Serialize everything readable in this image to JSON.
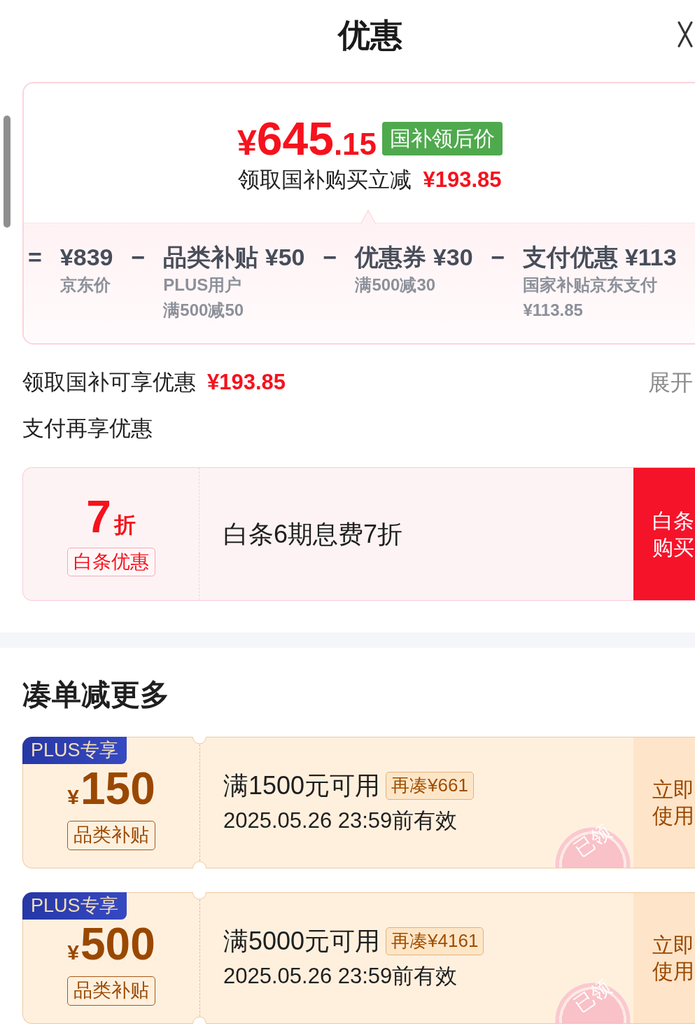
{
  "header": {
    "title": "优惠"
  },
  "price_card": {
    "price": {
      "symbol": "¥",
      "whole": "645",
      "fraction": ".15"
    },
    "tag": "国补领后价",
    "saving_label": "领取国补购买立减",
    "saving_amount": "¥193.85",
    "breakdown": [
      {
        "operator": "=",
        "title": "¥839",
        "notes": [
          "京东价"
        ]
      },
      {
        "operator": "−",
        "title": "品类补贴 ¥50",
        "notes": [
          "PLUS用户",
          "满500减50"
        ]
      },
      {
        "operator": "−",
        "title": "优惠券 ¥30",
        "notes": [
          "满500减30"
        ]
      },
      {
        "operator": "−",
        "title": "支付优惠 ¥113",
        "notes": [
          "国家补贴京东支付",
          "¥113.85"
        ]
      }
    ]
  },
  "subsidy_summary": {
    "label": "领取国补可享优惠",
    "amount": "¥193.85",
    "toggle": "展开"
  },
  "payment_offers": {
    "title": "支付再享优惠",
    "items": [
      {
        "rate": "7",
        "unit": "折",
        "tag": "白条优惠",
        "description": "白条6期息费7折",
        "action": "白条购买"
      }
    ]
  },
  "bundle_section": {
    "title": "凑单减更多",
    "coupons": [
      {
        "badge": "PLUS专享",
        "currency": "¥",
        "amount": "150",
        "category": "品类补贴",
        "condition": "满1500元可用",
        "top_up": "再凑¥661",
        "validity": "2025.05.26 23:59前有效",
        "action": "立即使用",
        "stamp": "已领"
      },
      {
        "badge": "PLUS专享",
        "currency": "¥",
        "amount": "500",
        "category": "品类补贴",
        "condition": "满5000元可用",
        "top_up": "再凑¥4161",
        "validity": "2025.05.26 23:59前有效",
        "action": "立即使用",
        "stamp": "已领"
      }
    ]
  }
}
